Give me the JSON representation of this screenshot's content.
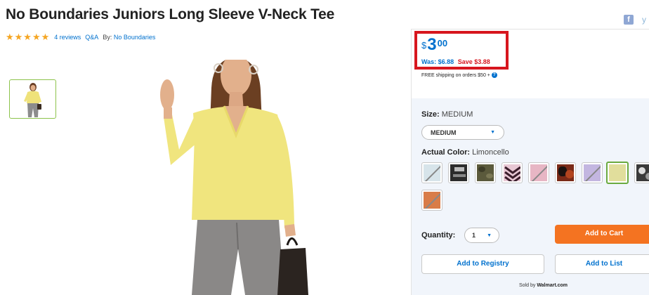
{
  "product": {
    "title": "No Boundaries Juniors Long Sleeve V-Neck Tee",
    "rating_stars": "★★★★★",
    "reviews_label": "4 reviews",
    "qa_label": "Q&A",
    "by_label": "By:",
    "brand": "No Boundaries"
  },
  "social": {
    "facebook_icon": "facebook-icon",
    "twitter_icon": "twitter-icon"
  },
  "price": {
    "currency": "$",
    "dollars": "3",
    "cents": "00",
    "was_label": "Was: $6.88",
    "save_label": "Save $3.88",
    "shipping_text": "FREE shipping on orders $50 +",
    "help_glyph": "?"
  },
  "options": {
    "size_label": "Size:",
    "size_value": "MEDIUM",
    "size_select_value": "MEDIUM",
    "color_label": "Actual Color:",
    "color_value": "Limoncello",
    "swatches": [
      {
        "name": "swatch-1",
        "color": "#d7e4ea",
        "unavailable": true
      },
      {
        "name": "swatch-2",
        "color": "#2c2c2c",
        "unavailable": false
      },
      {
        "name": "swatch-3",
        "color": "#5b5a3c",
        "unavailable": false
      },
      {
        "name": "swatch-4",
        "color": "#e8c7d4",
        "unavailable": false
      },
      {
        "name": "swatch-5",
        "color": "#e7b6c4",
        "unavailable": true
      },
      {
        "name": "swatch-6",
        "color": "#7a2a18",
        "unavailable": false
      },
      {
        "name": "swatch-7",
        "color": "#c3b6e0",
        "unavailable": true
      },
      {
        "name": "swatch-8",
        "color": "#e1de9c",
        "unavailable": false,
        "selected": true
      },
      {
        "name": "swatch-9",
        "color": "#3a3a3a",
        "unavailable": false
      },
      {
        "name": "swatch-10",
        "color": "#d97c48",
        "unavailable": true
      }
    ],
    "quantity_label": "Quantity:",
    "quantity_value": "1"
  },
  "actions": {
    "add_to_cart": "Add to Cart",
    "add_to_registry": "Add to Registry",
    "add_to_list": "Add to List",
    "sold_by_prefix": "Sold by",
    "sold_by_name": "Walmart.com"
  },
  "colors": {
    "accent_blue": "#0071ce",
    "cart_orange": "#f47321",
    "price_border_red": "#d7161e",
    "star_gold": "#f5a623"
  }
}
